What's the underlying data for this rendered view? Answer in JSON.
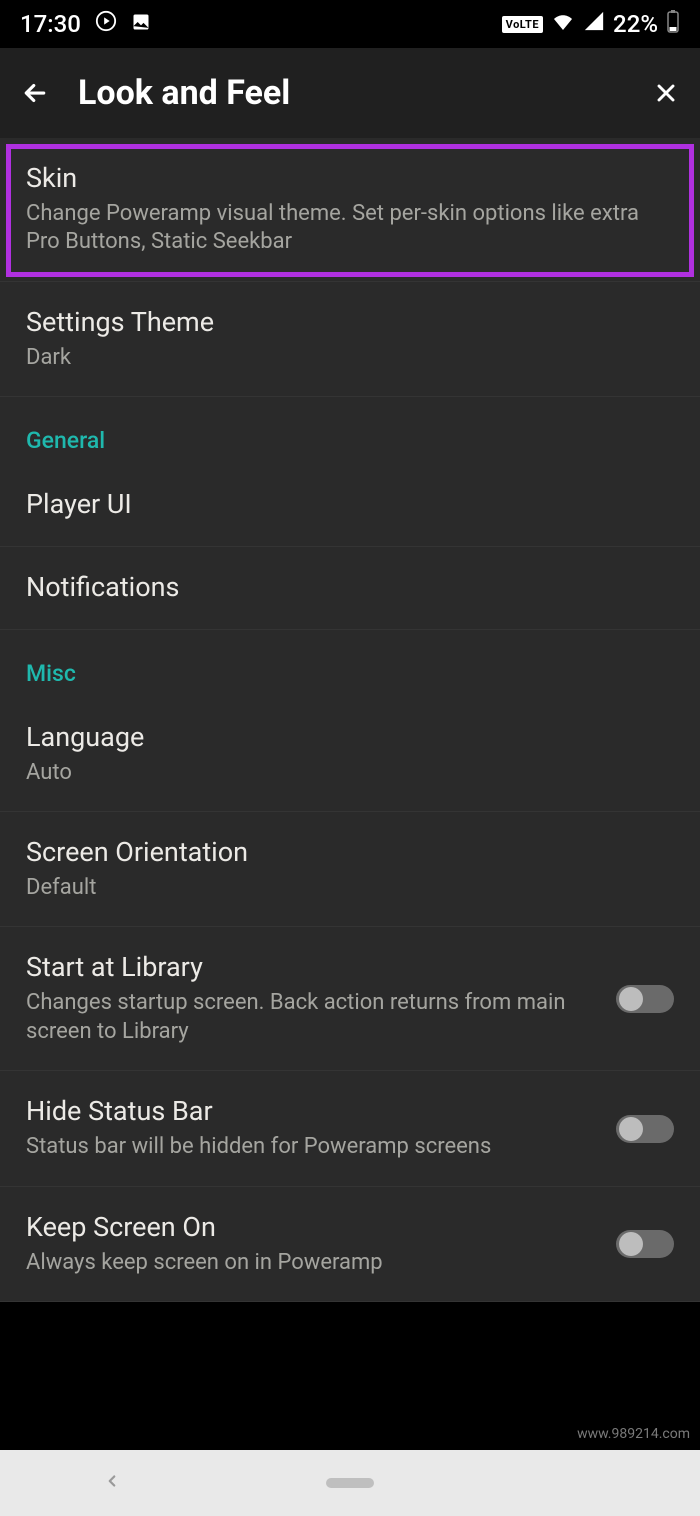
{
  "statusbar": {
    "time": "17:30",
    "volte": "VoLTE",
    "battery": "22%"
  },
  "header": {
    "title": "Look and Feel"
  },
  "rows": {
    "skin": {
      "title": "Skin",
      "sub": "Change Poweramp visual theme. Set per-skin options like extra Pro Buttons, Static Seekbar"
    },
    "settingsTheme": {
      "title": "Settings Theme",
      "sub": "Dark"
    },
    "general": "General",
    "playerUI": "Player UI",
    "notifications": "Notifications",
    "misc": "Misc",
    "language": {
      "title": "Language",
      "sub": "Auto"
    },
    "orientation": {
      "title": "Screen Orientation",
      "sub": "Default"
    },
    "startLib": {
      "title": "Start at Library",
      "sub": "Changes startup screen. Back action returns from main screen to Library"
    },
    "hideStatus": {
      "title": "Hide Status Bar",
      "sub": "Status bar will be hidden for Poweramp screens"
    },
    "keepScreen": {
      "title": "Keep Screen On",
      "sub": "Always keep screen on in Poweramp"
    }
  },
  "watermark": "www.989214.com"
}
